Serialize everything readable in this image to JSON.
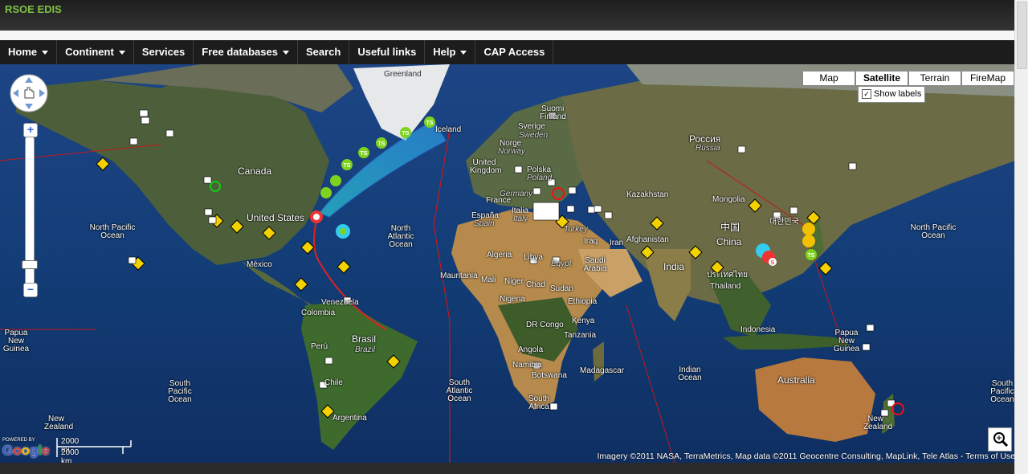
{
  "app": {
    "brand": "RSOE EDIS"
  },
  "nav": [
    {
      "label": "Home",
      "dropdown": true
    },
    {
      "label": "Continent",
      "dropdown": true
    },
    {
      "label": "Services",
      "dropdown": false
    },
    {
      "label": "Free databases",
      "dropdown": true
    },
    {
      "label": "Search",
      "dropdown": false
    },
    {
      "label": "Useful links",
      "dropdown": false
    },
    {
      "label": "Help",
      "dropdown": true
    },
    {
      "label": "CAP Access",
      "dropdown": false
    }
  ],
  "map": {
    "types": [
      "Map",
      "Satellite",
      "Terrain",
      "FireMap"
    ],
    "active_type": "Satellite",
    "show_labels": {
      "label": "Show labels",
      "checked": true
    },
    "zoom_in": "+",
    "zoom_out": "−",
    "scale_mi": "2000 mi",
    "scale_km": "2000 km",
    "powered_by": "POWERED BY",
    "google_logo": "Google",
    "copyright": "Imagery ©2011 NASA, TerraMetrics, Map data ©2011 Geocentre Consulting, MapLink, Tele Atlas - Terms of Use",
    "labels": {
      "greenland": "Greenland",
      "canada": "Canada",
      "united_states": "United States",
      "mexico": "México",
      "north_pacific_1": "North Pacific Ocean",
      "north_pacific_2": "North Pacific Ocean",
      "north_atlantic": "North Atlantic Ocean",
      "venezuela": "Venezuela",
      "colombia": "Colombia",
      "peru": "Perú",
      "brasil": "Brasil",
      "brazil_alt": "Brazil",
      "chile": "Chile",
      "argentina": "Argentina",
      "south_pacific_1": "South Pacific Ocean",
      "south_pacific_2": "South Pacific Ocean",
      "south_atlantic": "South Atlantic Ocean",
      "new_zealand_1": "New Zealand",
      "new_zealand_2": "New Zealand",
      "papua_1": "Papua New Guinea",
      "papua_2": "Papua New Guinea",
      "iceland": "Iceland",
      "suomi": "Suomi",
      "finland": "Finland",
      "sverige": "Sverige",
      "sweden": "Sweden",
      "norge": "Norge",
      "norway": "Norway",
      "united_kingdom": "United Kingdom",
      "polska": "Polska",
      "poland": "Poland",
      "germany": "Germany",
      "france": "France",
      "espana": "España",
      "spain": "Spain",
      "italia": "Italia",
      "italy": "Italy",
      "turkey": "Turkey",
      "rossiya": "Россия",
      "russia": "Russia",
      "kazakhstan": "Kazakhstan",
      "mongolia": "Mongolia",
      "china_cn": "中国",
      "china": "China",
      "korea": "대한민국",
      "afghanistan": "Afghanistan",
      "iraq": "Iraq",
      "iran": "Iran",
      "egypt": "Egypt",
      "saudi": "Saudi Arabia",
      "india": "India",
      "thailand_th": "ประเทศไทย",
      "thailand": "Thailand",
      "algeria": "Algeria",
      "libya": "Libya",
      "mauritania": "Mauritania",
      "mali": "Mali",
      "niger": "Niger",
      "chad": "Chad",
      "sudan": "Sudan",
      "nigeria": "Nigeria",
      "ethiopia": "Ethiopia",
      "dr_congo": "DR Congo",
      "kenya": "Kenya",
      "tanzania": "Tanzania",
      "angola": "Angola",
      "namibia": "Namibia",
      "botswana": "Botswana",
      "madagascar": "Madagascar",
      "south_africa": "South Africa",
      "indian_ocean": "Indian Ocean",
      "indonesia": "Indonesia",
      "australia": "Australia",
      "storm_ts": "TS",
      "storm_s": "S"
    }
  }
}
